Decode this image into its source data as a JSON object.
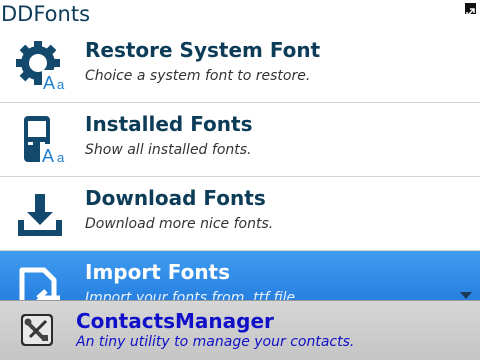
{
  "window": {
    "title": "DDFonts",
    "expand_icon": "expand-icon"
  },
  "menu": {
    "items": [
      {
        "icon": "gear-font-icon",
        "label": "Restore System Font",
        "description": "Choice a system font to restore."
      },
      {
        "icon": "phone-font-icon",
        "label": "Installed Fonts",
        "description": "Show all installed fonts."
      },
      {
        "icon": "download-icon",
        "label": "Download Fonts",
        "description": "Download more nice fonts."
      },
      {
        "icon": "import-icon",
        "label": "Import Fonts",
        "description": "Import your fonts from .ttf file.",
        "selected": true
      }
    ]
  },
  "notification": {
    "icon": "tools-icon",
    "title": "ContactsManager",
    "description": "An tiny utility to manage your contacts."
  },
  "colors": {
    "accent": "#0d3c59",
    "selected": "#1b72d8",
    "notification_text": "#1010c8"
  }
}
